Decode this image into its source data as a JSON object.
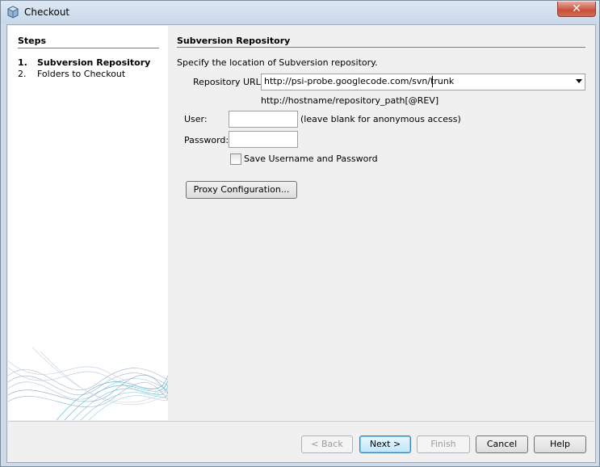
{
  "window": {
    "title": "Checkout",
    "close_glyph": "✕"
  },
  "steps": {
    "title": "Steps",
    "items": [
      {
        "num": "1.",
        "label": "Subversion Repository",
        "current": true
      },
      {
        "num": "2.",
        "label": "Folders to Checkout",
        "current": false
      }
    ]
  },
  "main": {
    "title": "Subversion Repository",
    "description": "Specify the location of Subversion repository.",
    "repository_url": {
      "label": "Repository URL:",
      "value": "http://psi-probe.googlecode.com/svn/trunk",
      "hint": "http://hostname/repository_path[@REV]"
    },
    "user": {
      "label": "User:",
      "value": "",
      "hint": "(leave blank for anonymous access)"
    },
    "password": {
      "label": "Password:",
      "value": ""
    },
    "save_credentials": {
      "label": "Save Username and Password",
      "checked": false
    },
    "proxy_button": "Proxy Configuration..."
  },
  "buttons": {
    "back": "< Back",
    "next": "Next >",
    "finish": "Finish",
    "cancel": "Cancel",
    "help": "Help"
  },
  "colors": {
    "title_bar": "#cfdbe8",
    "close_button": "#c7503a",
    "panel_background": "#f0f0f0",
    "wave_accent": "#4bb3d6"
  }
}
